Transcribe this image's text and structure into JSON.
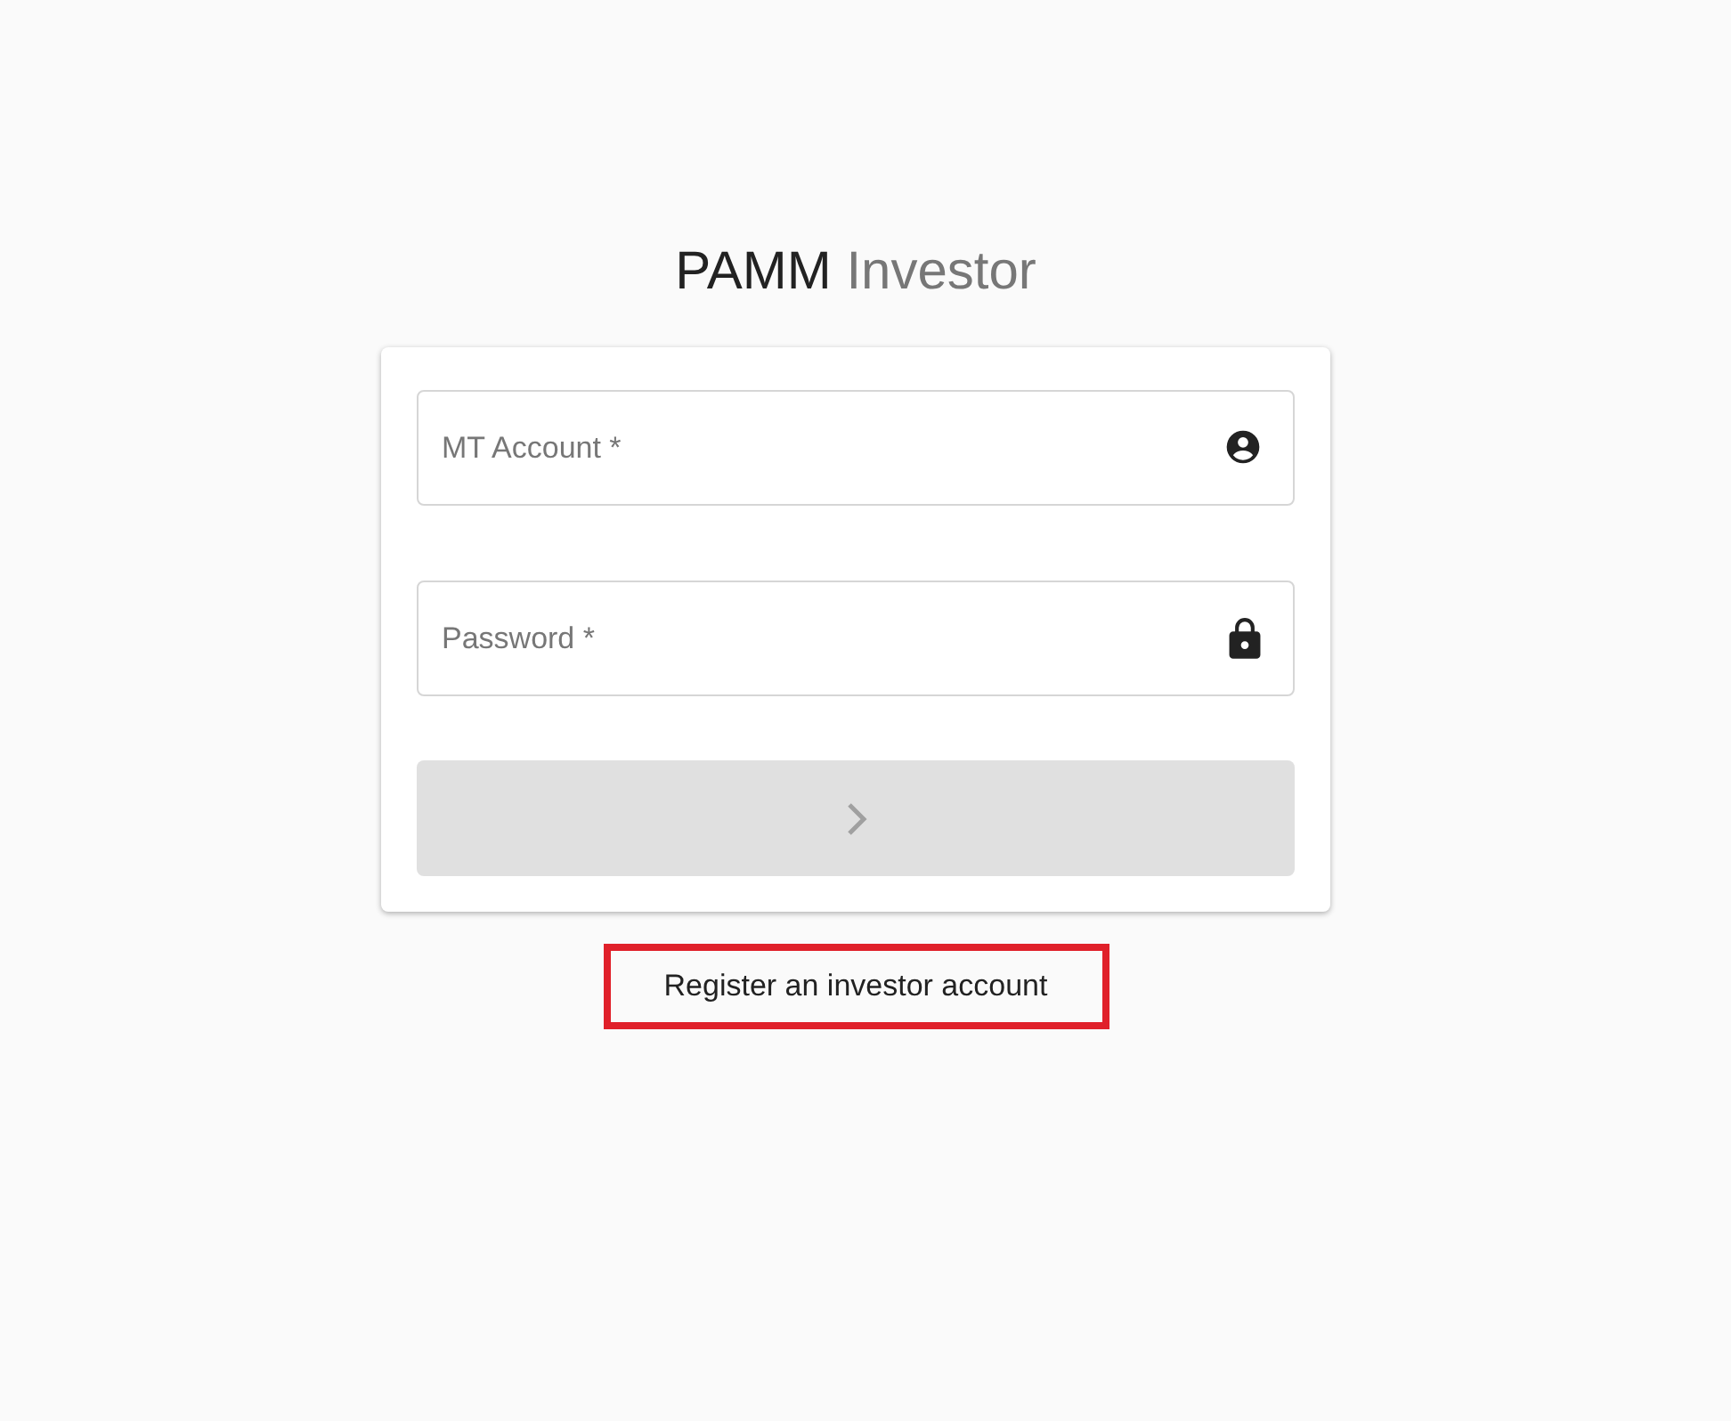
{
  "title": {
    "main": "PAMM",
    "accent": "Investor"
  },
  "fields": [
    {
      "kind": "account",
      "placeholder": "MT Account *"
    },
    {
      "kind": "password",
      "placeholder": "Password *"
    }
  ],
  "submit": {
    "disabled": true
  },
  "register_link": {
    "label": "Register an investor account",
    "highlighted": true
  }
}
